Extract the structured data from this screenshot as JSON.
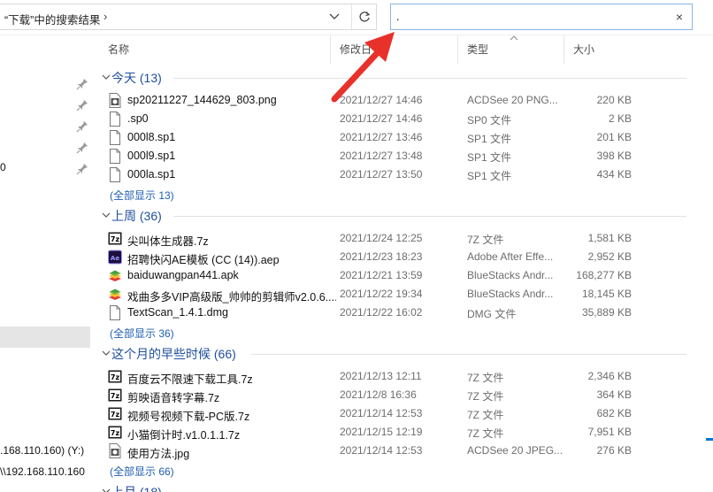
{
  "address": {
    "breadcrumb": "“下载”中的搜索结果",
    "chevron": "›"
  },
  "search": {
    "value": ".",
    "clear_glyph": "×"
  },
  "columns": {
    "name": "名称",
    "date": "修改日",
    "type": "类型",
    "size": "大小"
  },
  "nav": {
    "items": [
      {
        "text": "0"
      },
      {
        "text": ".168.110.160) (Y:)"
      },
      {
        "text": "\\\\192.168.110.160"
      }
    ]
  },
  "groups": [
    {
      "title": "今天 (13)",
      "show_all": "(全部显示 13)",
      "rows": [
        {
          "icon": "png-icon",
          "name": "sp20211227_144629_803.png",
          "date": "2021/12/27 14:46",
          "type": "ACDSee 20 PNG...",
          "size": "220 KB"
        },
        {
          "icon": "file-icon",
          "name": ".sp0",
          "date": "2021/12/27 14:46",
          "type": "SP0 文件",
          "size": "2 KB"
        },
        {
          "icon": "file-icon",
          "name": "000l8.sp1",
          "date": "2021/12/27 13:46",
          "type": "SP1 文件",
          "size": "201 KB"
        },
        {
          "icon": "file-icon",
          "name": "000l9.sp1",
          "date": "2021/12/27 13:48",
          "type": "SP1 文件",
          "size": "398 KB"
        },
        {
          "icon": "file-icon",
          "name": "000la.sp1",
          "date": "2021/12/27 13:50",
          "type": "SP1 文件",
          "size": "434 KB"
        }
      ]
    },
    {
      "title": "上周 (36)",
      "show_all": "(全部显示 36)",
      "rows": [
        {
          "icon": "7z-icon",
          "name": "尖叫体生成器.7z",
          "date": "2021/12/24 12:25",
          "type": "7Z 文件",
          "size": "1,581 KB"
        },
        {
          "icon": "ae-icon",
          "name": "招聘快闪AE模板 (CC (14)).aep",
          "date": "2021/12/23 18:23",
          "type": "Adobe After Effe...",
          "size": "2,952 KB"
        },
        {
          "icon": "bluestacks-icon",
          "name": "baiduwangpan441.apk",
          "date": "2021/12/21 13:59",
          "type": "BlueStacks Andr...",
          "size": "168,277 KB"
        },
        {
          "icon": "bluestacks-icon",
          "name": "戏曲多多VIP高级版_帅帅的剪辑师v2.0.6....",
          "date": "2021/12/22 19:34",
          "type": "BlueStacks Andr...",
          "size": "18,145 KB"
        },
        {
          "icon": "file-icon",
          "name": "TextScan_1.4.1.dmg",
          "date": "2021/12/22 16:02",
          "type": "DMG 文件",
          "size": "35,889 KB"
        }
      ]
    },
    {
      "title": "这个月的早些时候 (66)",
      "show_all": "(全部显示 66)",
      "rows": [
        {
          "icon": "7z-icon",
          "name": "百度云不限速下载工具.7z",
          "date": "2021/12/13 12:11",
          "type": "7Z 文件",
          "size": "2,346 KB"
        },
        {
          "icon": "7z-icon",
          "name": "剪映语音转字幕.7z",
          "date": "2021/12/8 16:36",
          "type": "7Z 文件",
          "size": "364 KB"
        },
        {
          "icon": "7z-icon",
          "name": "视频号视频下载-PC版.7z",
          "date": "2021/12/14 12:53",
          "type": "7Z 文件",
          "size": "682 KB"
        },
        {
          "icon": "7z-icon",
          "name": "小猫倒计时.v1.0.1.1.7z",
          "date": "2021/12/15 12:19",
          "type": "7Z 文件",
          "size": "7,951 KB"
        },
        {
          "icon": "jpg-icon",
          "name": "使用方法.jpg",
          "date": "2021/12/14 12:53",
          "type": "ACDSee 20 JPEG...",
          "size": "276 KB"
        }
      ]
    },
    {
      "title": "上月 (18)"
    }
  ],
  "colors": {
    "accent": "#0078d7",
    "group_title": "#1f4e9e",
    "link": "#1f5fb0",
    "arrow": "#e8312b"
  }
}
